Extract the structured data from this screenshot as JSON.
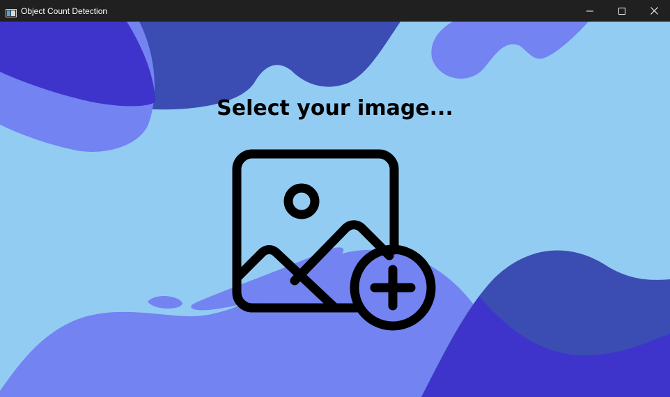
{
  "window": {
    "title": "Object Count Detection",
    "icon": "app-window-icon",
    "controls": {
      "minimize_icon": "minimize-icon",
      "maximize_icon": "maximize-icon",
      "close_icon": "close-icon"
    }
  },
  "main": {
    "heading": "Select your image...",
    "upload_icon": "add-image-icon"
  },
  "colors": {
    "background": "#93CCF2",
    "blob_dark": "#3B4DB3",
    "blob_medium": "#7383F2",
    "blob_deep": "#3E34CC",
    "titlebar": "#202020",
    "icon_stroke": "#000000"
  }
}
